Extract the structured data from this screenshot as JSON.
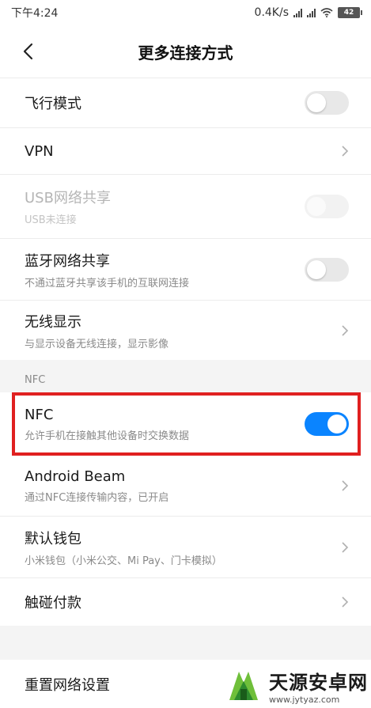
{
  "status_bar": {
    "time": "下午4:24",
    "net_speed": "0.4K/s",
    "battery": "42"
  },
  "header": {
    "title": "更多连接方式"
  },
  "rows": [
    {
      "title": "飞行模式",
      "subtitle": "",
      "control": "toggle",
      "state": "off"
    },
    {
      "title": "VPN",
      "subtitle": "",
      "control": "chevron"
    },
    {
      "title": "USB网络共享",
      "subtitle": "USB未连接",
      "control": "toggle",
      "state": "disabled"
    },
    {
      "title": "蓝牙网络共享",
      "subtitle": "不通过蓝牙共享该手机的互联网连接",
      "control": "toggle",
      "state": "off"
    },
    {
      "title": "无线显示",
      "subtitle": "与显示设备无线连接，显示影像",
      "control": "chevron"
    }
  ],
  "nfc_section": {
    "label": "NFC",
    "rows": [
      {
        "title": "NFC",
        "subtitle": "允许手机在接触其他设备时交换数据",
        "control": "toggle",
        "state": "on"
      },
      {
        "title": "Android Beam",
        "subtitle": "通过NFC连接传输内容，已开启",
        "control": "chevron"
      },
      {
        "title": "默认钱包",
        "subtitle": "小米钱包（小米公交、Mi Pay、门卡模拟）",
        "control": "chevron"
      },
      {
        "title": "触碰付款",
        "subtitle": "",
        "control": "chevron"
      }
    ]
  },
  "reset": {
    "title": "重置网络设置"
  },
  "watermark": {
    "title": "天源安卓网",
    "url": "www.jytyaz.com"
  },
  "colors": {
    "accent": "#0a84ff",
    "highlight": "#e02020"
  }
}
